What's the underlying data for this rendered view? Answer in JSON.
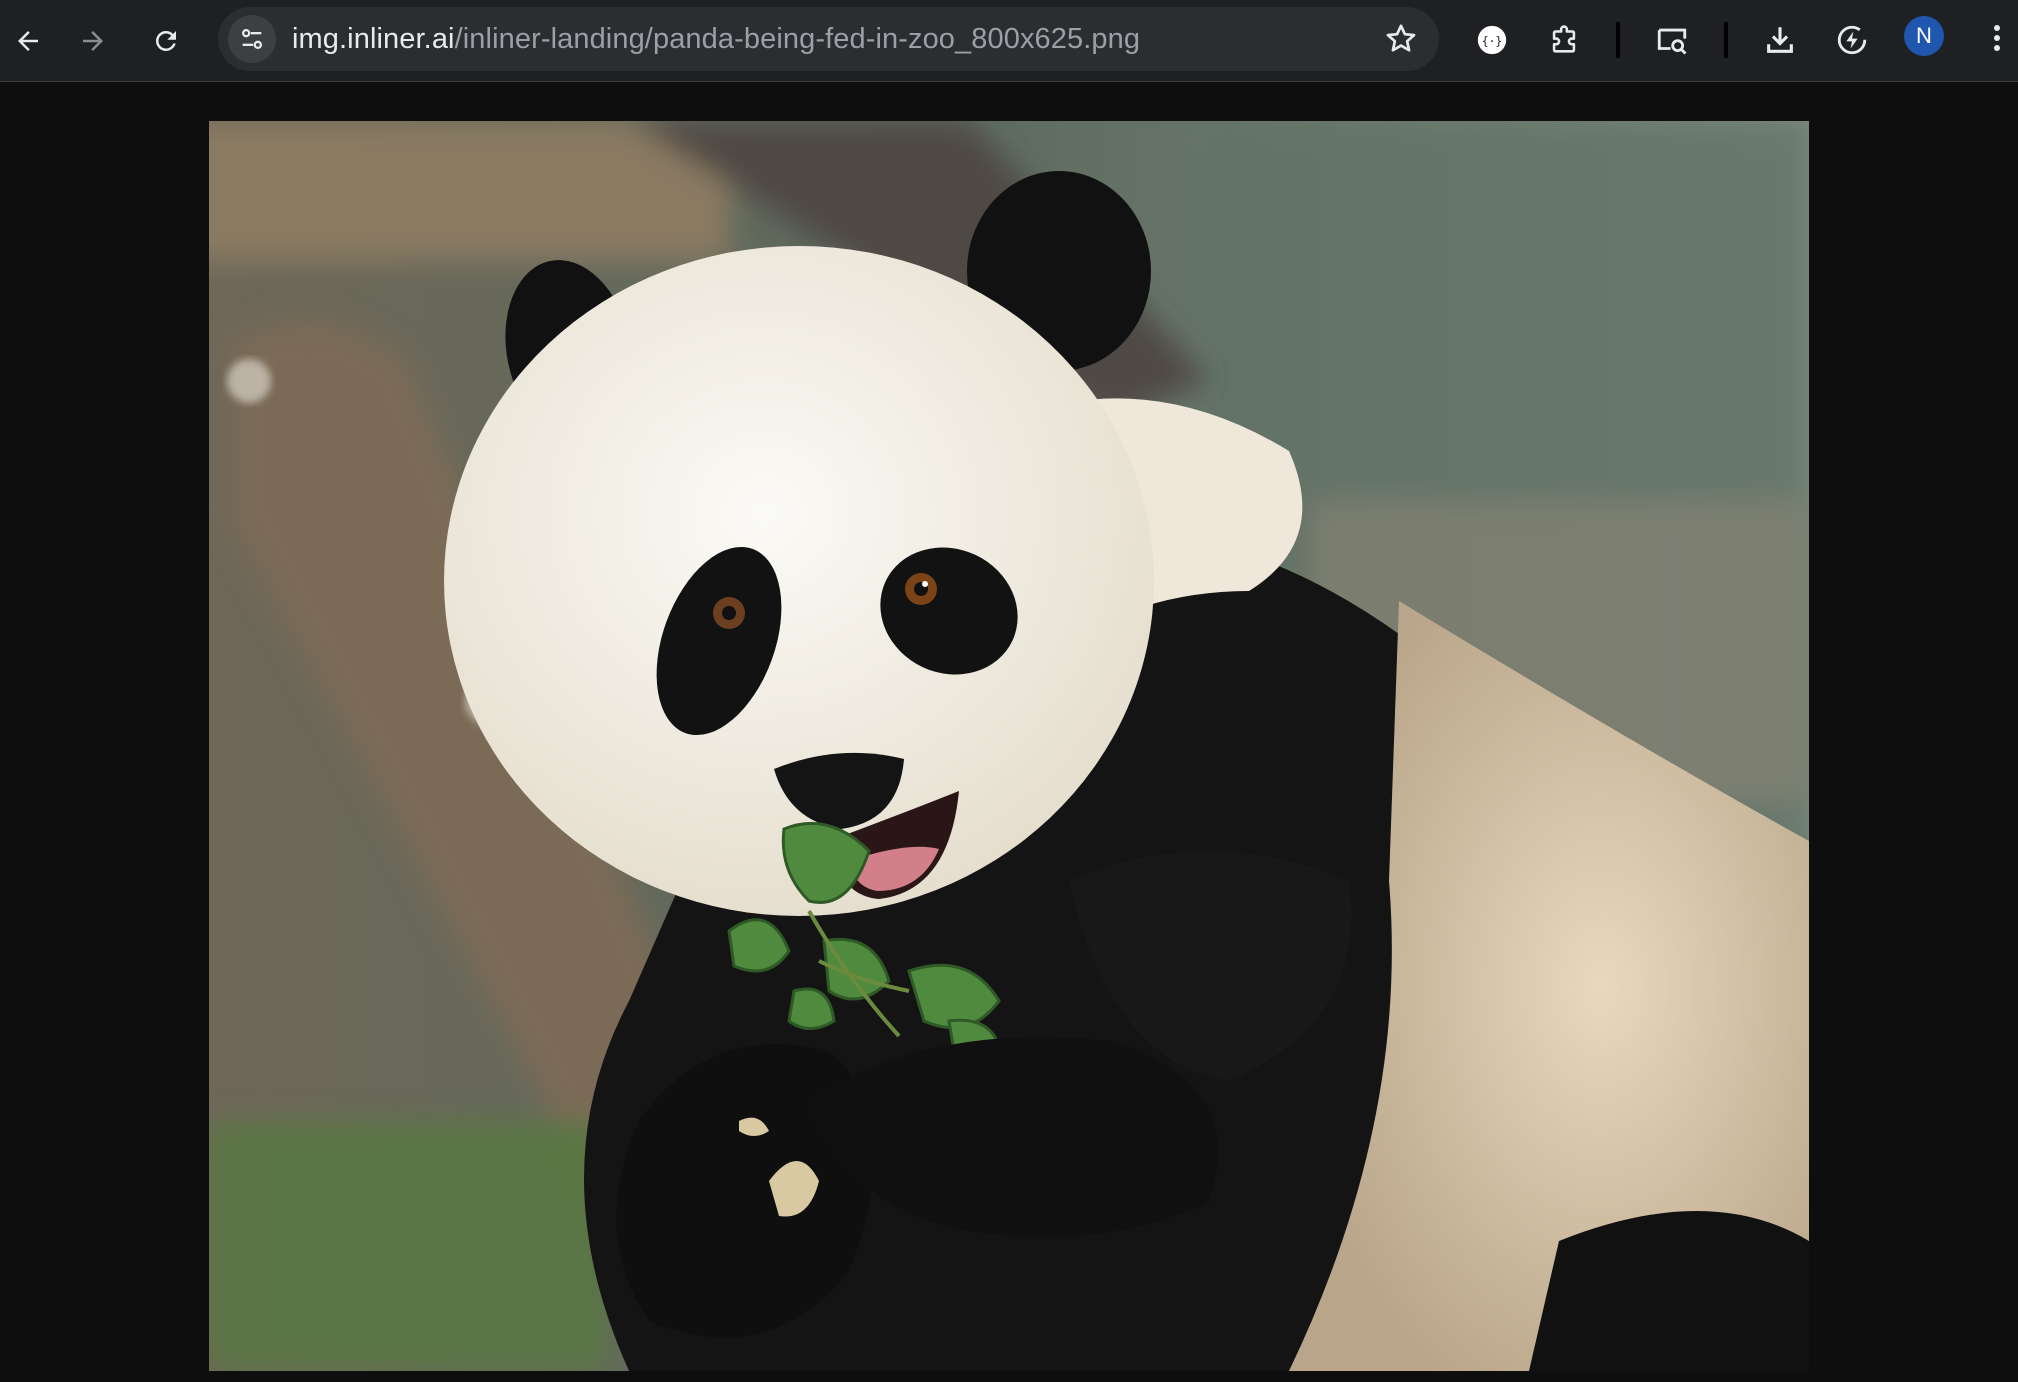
{
  "browser": {
    "url_host": "img.inliner.ai",
    "url_path": "/inliner-landing/panda-being-fed-in-zoo_800x625.png",
    "profile_initial": "N",
    "icons": {
      "back": "arrow-left-icon",
      "forward": "arrow-right-icon",
      "reload": "reload-icon",
      "site_info": "tune-icon",
      "bookmark": "star-icon",
      "extension": "extension-circle-icon",
      "extensions": "puzzle-icon",
      "cast": "screen-search-icon",
      "download": "download-icon",
      "performance": "bolt-icon",
      "menu": "more-vert-icon"
    }
  },
  "image": {
    "subject": "panda-photo",
    "accent_colors": {
      "fur_black": "#121212",
      "fur_white": "#f2efe8",
      "leaves": "#4f8a3e"
    }
  }
}
